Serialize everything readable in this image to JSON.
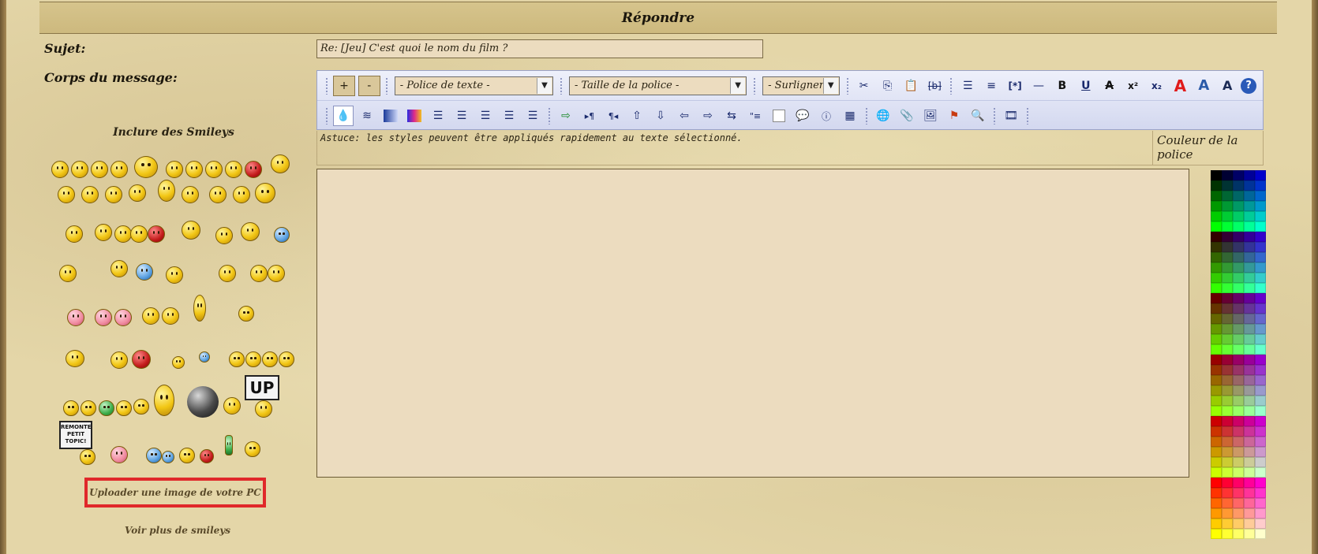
{
  "header": {
    "title": "Répondre"
  },
  "form": {
    "subject_label": "Sujet:",
    "subject_value": "Re: [Jeu] C'est quoi le nom du film ?",
    "body_label": "Corps du message:"
  },
  "smileys": {
    "title": "Inclure des Smileys",
    "upload_label": "Uploader une image de votre PC",
    "more_label": "Voir plus de smileys",
    "sign_up": "UP",
    "sign_remonte": "REMONTE PETIT TOPIC!"
  },
  "toolbar": {
    "font_increase": "+",
    "font_decrease": "-",
    "font_family_select": "- Police de texte -",
    "font_size_select": "- Taille de la police -",
    "highlight_select": "- Surligner -",
    "bold_glyph": "B",
    "underline_glyph": "U",
    "strike_glyph": "A",
    "sup_glyph": "x²",
    "sub_glyph": "x₂",
    "list_tag_glyph": "[*]",
    "code_tag_glyph": "[b]",
    "help_glyph": "?",
    "icons_row1": [
      "increase-font-icon",
      "decrease-font-icon",
      "cut-icon",
      "copy-icon",
      "paste-icon",
      "strikethrough-b-icon",
      "bullet-list-icon",
      "numbered-list-icon",
      "list-item-icon",
      "horizontal-rule-icon",
      "bold-icon",
      "underline-icon",
      "strikethrough-icon",
      "superscript-icon",
      "subscript-icon",
      "text-red-icon",
      "text-blue-icon",
      "text-shadow-icon",
      "help-icon"
    ],
    "icons_row2": [
      "color-drop-icon",
      "wave-icon",
      "gradient-icon",
      "rainbow-icon",
      "align-justify-icon",
      "align-left-icon",
      "align-center-icon",
      "align-right-icon",
      "align-full-icon",
      "insert-icon",
      "ltr-icon",
      "rtl-icon",
      "upload-icon",
      "download-icon",
      "export-icon",
      "import-icon",
      "scroll-icon",
      "indent-icon",
      "box-icon",
      "speech-icon",
      "info-icon",
      "table-icon",
      "globe-icon",
      "attach-icon",
      "image-icon",
      "flash-icon",
      "search-icon",
      "film-icon"
    ]
  },
  "editor": {
    "tip": "Astuce: les styles peuvent être appliqués rapidement au texte sélectionné.",
    "font_color_label": "Couleur de la police",
    "message_value": ""
  },
  "palette": {
    "colors": [
      "#000000",
      "#000033",
      "#000066",
      "#000099",
      "#0000cc",
      "#0000ff",
      "#003300",
      "#003333",
      "#003366",
      "#003399",
      "#0033cc",
      "#0033ff",
      "#006600",
      "#006633",
      "#006666",
      "#006699",
      "#0066cc",
      "#0066ff",
      "#009900",
      "#009933",
      "#009966",
      "#009999",
      "#0099cc",
      "#0099ff",
      "#00cc00",
      "#00cc33",
      "#00cc66",
      "#00cc99",
      "#00cccc",
      "#00ccff",
      "#00ff00",
      "#00ff33",
      "#00ff66",
      "#00ff99",
      "#00ffcc",
      "#00ffff",
      "#330000",
      "#330033",
      "#330066",
      "#330099",
      "#3300cc",
      "#3300ff",
      "#333300",
      "#333333",
      "#333366",
      "#333399",
      "#3333cc",
      "#3333ff",
      "#336600",
      "#336633",
      "#336666",
      "#336699",
      "#3366cc",
      "#3366ff",
      "#339900",
      "#339933",
      "#339966",
      "#339999",
      "#3399cc",
      "#3399ff",
      "#33cc00",
      "#33cc33",
      "#33cc66",
      "#33cc99",
      "#33cccc",
      "#33ccff",
      "#33ff00",
      "#33ff33",
      "#33ff66",
      "#33ff99",
      "#33ffcc",
      "#33ffff",
      "#660000",
      "#660033",
      "#660066",
      "#660099",
      "#6600cc",
      "#6600ff",
      "#663300",
      "#663333",
      "#663366",
      "#663399",
      "#6633cc",
      "#6633ff",
      "#666600",
      "#666633",
      "#666666",
      "#666699",
      "#6666cc",
      "#6666ff",
      "#669900",
      "#669933",
      "#669966",
      "#669999",
      "#6699cc",
      "#6699ff",
      "#66cc00",
      "#66cc33",
      "#66cc66",
      "#66cc99",
      "#66cccc",
      "#66ccff",
      "#66ff00",
      "#66ff33",
      "#66ff66",
      "#66ff99",
      "#66ffcc",
      "#66ffff",
      "#990000",
      "#990033",
      "#990066",
      "#990099",
      "#9900cc",
      "#9900ff",
      "#993300",
      "#993333",
      "#993366",
      "#993399",
      "#9933cc",
      "#9933ff",
      "#996600",
      "#996633",
      "#996666",
      "#996699",
      "#9966cc",
      "#9966ff",
      "#999900",
      "#999933",
      "#999966",
      "#999999",
      "#9999cc",
      "#9999ff",
      "#99cc00",
      "#99cc33",
      "#99cc66",
      "#99cc99",
      "#99cccc",
      "#99ccff",
      "#99ff00",
      "#99ff33",
      "#99ff66",
      "#99ff99",
      "#99ffcc",
      "#99ffff",
      "#cc0000",
      "#cc0033",
      "#cc0066",
      "#cc0099",
      "#cc00cc",
      "#cc00ff",
      "#cc3300",
      "#cc3333",
      "#cc3366",
      "#cc3399",
      "#cc33cc",
      "#cc33ff",
      "#cc6600",
      "#cc6633",
      "#cc6666",
      "#cc6699",
      "#cc66cc",
      "#cc66ff",
      "#cc9900",
      "#cc9933",
      "#cc9966",
      "#cc9999",
      "#cc99cc",
      "#cc99ff",
      "#cccc00",
      "#cccc33",
      "#cccc66",
      "#cccc99",
      "#cccccc",
      "#ccccff",
      "#ccff00",
      "#ccff33",
      "#ccff66",
      "#ccff99",
      "#ccffcc",
      "#ccffff",
      "#ff0000",
      "#ff0033",
      "#ff0066",
      "#ff0099",
      "#ff00cc",
      "#ff00ff",
      "#ff3300",
      "#ff3333",
      "#ff3366",
      "#ff3399",
      "#ff33cc",
      "#ff33ff",
      "#ff6600",
      "#ff6633",
      "#ff6666",
      "#ff6699",
      "#ff66cc",
      "#ff66ff",
      "#ff9900",
      "#ff9933",
      "#ff9966",
      "#ff9999",
      "#ff99cc",
      "#ff99ff",
      "#ffcc00",
      "#ffcc33",
      "#ffcc66",
      "#ffcc99",
      "#ffcccc",
      "#ffccff",
      "#ffff00",
      "#ffff33",
      "#ffff66",
      "#ffff99",
      "#ffffcc",
      "#ffffff"
    ]
  },
  "colors": {
    "highlight_border": "#e0282a",
    "toolbar_bg": "#dfe3f5",
    "input_bg": "#ecdcbf"
  }
}
